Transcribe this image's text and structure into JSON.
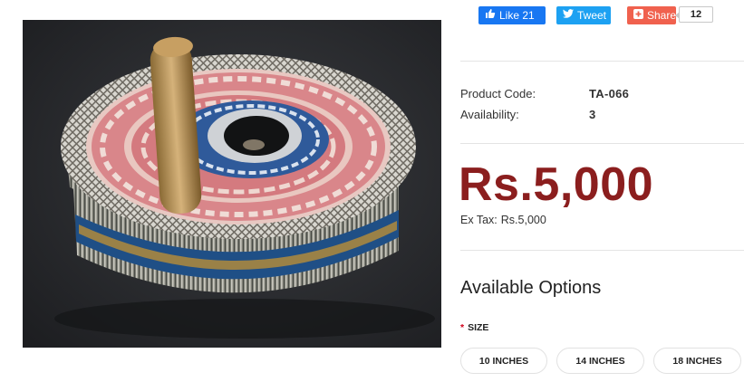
{
  "share": {
    "like_label": "Like 21",
    "tweet_label": "Tweet",
    "share_label": "Share",
    "share_count": "12"
  },
  "product": {
    "code_label": "Product Code:",
    "code_value": "TA-066",
    "availability_label": "Availability:",
    "availability_value": "3"
  },
  "price": {
    "main": "Rs.5,000",
    "ex_tax_label": "Ex Tax:",
    "ex_tax_value": "Rs.5,000"
  },
  "options": {
    "title": "Available Options",
    "size_required_mark": "*",
    "size_label": "SIZE",
    "sizes": [
      "10 INCHES",
      "14 INCHES",
      "18 INCHES"
    ]
  },
  "colors": {
    "facebook": "#1877f2",
    "twitter": "#1da1f2",
    "plus": "#f0614e",
    "price": "#8b1e1e"
  },
  "icons": [
    "thumbs-up-icon",
    "twitter-bird-icon",
    "plus-icon"
  ]
}
